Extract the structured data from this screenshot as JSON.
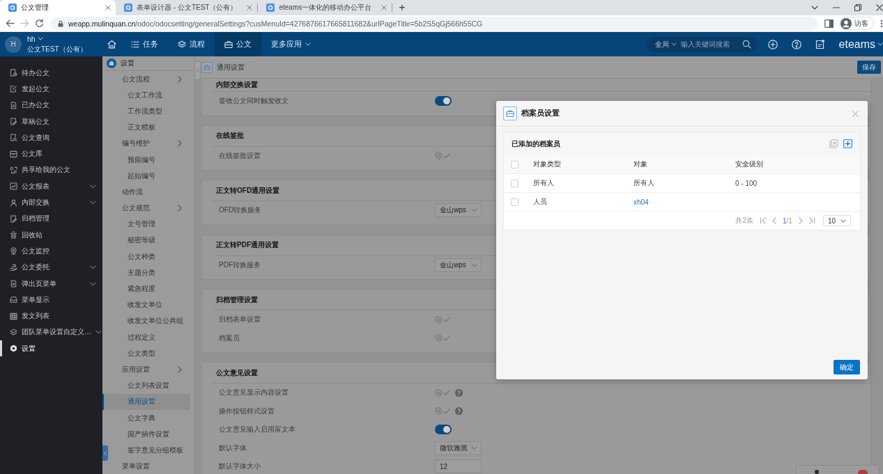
{
  "browser": {
    "tabs": [
      {
        "title": "公文管理",
        "selected": true
      },
      {
        "title": "表单设计器 - 公文TEST（公有）",
        "selected": false
      },
      {
        "title": "eteams一体化的移动办公平台",
        "selected": false
      }
    ],
    "new_tab": "+",
    "url": {
      "host": "weapp.mulinquan.cn",
      "path": "/odoc/odocsetting/generalSettings?cusMenuId=4276876617665811682&urlPageTitle=5b2S5qGj566h55CG"
    },
    "profile": "访客"
  },
  "header": {
    "avatar": "H",
    "user": "hh",
    "company": "公文TEST（公有）",
    "nav": [
      {
        "kind": "icon",
        "selected": false
      },
      {
        "kind": "item",
        "label": "任务",
        "selected": false
      },
      {
        "kind": "item",
        "label": "流程",
        "selected": false
      },
      {
        "kind": "item",
        "label": "公文",
        "selected": true
      },
      {
        "kind": "menu",
        "label": "更多应用",
        "selected": false
      }
    ],
    "search": {
      "scope": "全局",
      "placeholder": "输入关键词搜索"
    },
    "brand": "eteams"
  },
  "sidebar": {
    "items": [
      {
        "label": "待办公文",
        "kind": "page",
        "selected": false
      },
      {
        "label": "发起公文",
        "kind": "page",
        "selected": false
      },
      {
        "label": "已办公文",
        "kind": "page",
        "selected": false
      },
      {
        "label": "草稿公文",
        "kind": "page",
        "selected": false
      },
      {
        "label": "公文查询",
        "kind": "page",
        "selected": false
      },
      {
        "label": "公文库",
        "kind": "page",
        "selected": false
      },
      {
        "label": "共享给我的公文",
        "kind": "page",
        "selected": false
      },
      {
        "label": "公文报表",
        "kind": "folder",
        "selected": false
      },
      {
        "label": "内部交换",
        "kind": "folder",
        "selected": false
      },
      {
        "label": "归档管理",
        "kind": "page",
        "selected": false
      },
      {
        "label": "回收站",
        "kind": "page",
        "selected": false
      },
      {
        "label": "公文监控",
        "kind": "page",
        "selected": false
      },
      {
        "label": "公文委托",
        "kind": "folder",
        "selected": false
      },
      {
        "label": "弹出页菜单",
        "kind": "folder",
        "selected": false
      },
      {
        "label": "菜单显示",
        "kind": "page",
        "selected": false
      },
      {
        "label": "发文列表",
        "kind": "page",
        "selected": false
      },
      {
        "label": "团队菜单设置自定义…",
        "kind": "folder",
        "selected": false
      },
      {
        "label": "设置",
        "kind": "page",
        "selected": true
      }
    ]
  },
  "subnav": {
    "title": "设置",
    "items": [
      {
        "label": "公文流程",
        "selected": false,
        "children": [
          {
            "label": "公文工作流",
            "selected": false
          },
          {
            "label": "工作流类型",
            "selected": false
          },
          {
            "label": "正文模板",
            "selected": false
          }
        ]
      },
      {
        "label": "编号维护",
        "selected": false,
        "children": [
          {
            "label": "预留编号",
            "selected": false
          },
          {
            "label": "起始编号",
            "selected": false
          }
        ]
      },
      {
        "label": "动作流",
        "selected": false
      },
      {
        "label": "公文规范",
        "selected": false,
        "children": [
          {
            "label": "文号管理",
            "selected": false
          },
          {
            "label": "秘密等级",
            "selected": false
          },
          {
            "label": "公文种类",
            "selected": false
          },
          {
            "label": "主题分类",
            "selected": false
          },
          {
            "label": "紧急程度",
            "selected": false
          },
          {
            "label": "收发文单位",
            "selected": false
          },
          {
            "label": "收发文单位公共组",
            "selected": false
          },
          {
            "label": "过程定义",
            "selected": false
          },
          {
            "label": "公文类型",
            "selected": false
          }
        ]
      },
      {
        "label": "应用设置",
        "selected": false,
        "children": [
          {
            "label": "公文列表设置",
            "selected": false
          },
          {
            "label": "通用设置",
            "selected": true
          },
          {
            "label": "公文字典",
            "selected": false
          },
          {
            "label": "国产插件设置",
            "selected": false
          },
          {
            "label": "签字意见分组模板",
            "selected": false
          }
        ]
      },
      {
        "label": "菜单设置",
        "selected": false
      }
    ]
  },
  "page": {
    "title": "通用设置",
    "save": "保存",
    "sections": [
      {
        "title": "内部交换设置",
        "rows": [
          {
            "label": "签收公文同时触发收文",
            "kind": "toggle",
            "on": true
          }
        ]
      },
      {
        "title": "在线签批",
        "rows": [
          {
            "label": "在线签批设置",
            "kind": "config",
            "configured": true,
            "help": false
          }
        ]
      },
      {
        "title": "正文转OFD通用设置",
        "rows": [
          {
            "label": "OFD转换服务",
            "kind": "select",
            "value": "金山wps"
          }
        ]
      },
      {
        "title": "正文转PDF通用设置",
        "rows": [
          {
            "label": "PDF转换服务",
            "kind": "select",
            "value": "金山wps"
          }
        ]
      },
      {
        "title": "归档管理设置",
        "rows": [
          {
            "label": "归档表单设置",
            "kind": "config",
            "configured": true,
            "help": false
          },
          {
            "label": "档案员",
            "kind": "config",
            "configured": true,
            "help": false
          }
        ]
      },
      {
        "title": "公文意见设置",
        "rows": [
          {
            "label": "公文意见显示内容设置",
            "kind": "config",
            "configured": true,
            "help": true
          },
          {
            "label": "操作按钮样式设置",
            "kind": "config",
            "configured": true,
            "help": true
          },
          {
            "label": "公文意见输入启用富文本",
            "kind": "toggle",
            "on": true
          },
          {
            "label": "默认字体",
            "kind": "select",
            "value": "微软雅黑"
          },
          {
            "label": "默认字体大小",
            "kind": "input",
            "value": "12"
          }
        ]
      }
    ]
  },
  "dialog": {
    "title": "档案员设置",
    "panel_title": "已添加的档案员",
    "header_checked": false,
    "columns": [
      "对象类型",
      "对象",
      "安全级别"
    ],
    "rows": [
      {
        "checked": false,
        "cells": [
          {
            "kind": "text",
            "text": "所有人"
          },
          {
            "kind": "text",
            "text": "所有人"
          },
          {
            "kind": "text",
            "text": "0 - 100"
          }
        ]
      },
      {
        "checked": false,
        "cells": [
          {
            "kind": "text",
            "text": "人员"
          },
          {
            "kind": "link",
            "text": "xh04"
          }
        ]
      }
    ],
    "total": "共2条",
    "page_current": "1",
    "page_total": "/1",
    "page_size": "10",
    "confirm": "确定"
  }
}
